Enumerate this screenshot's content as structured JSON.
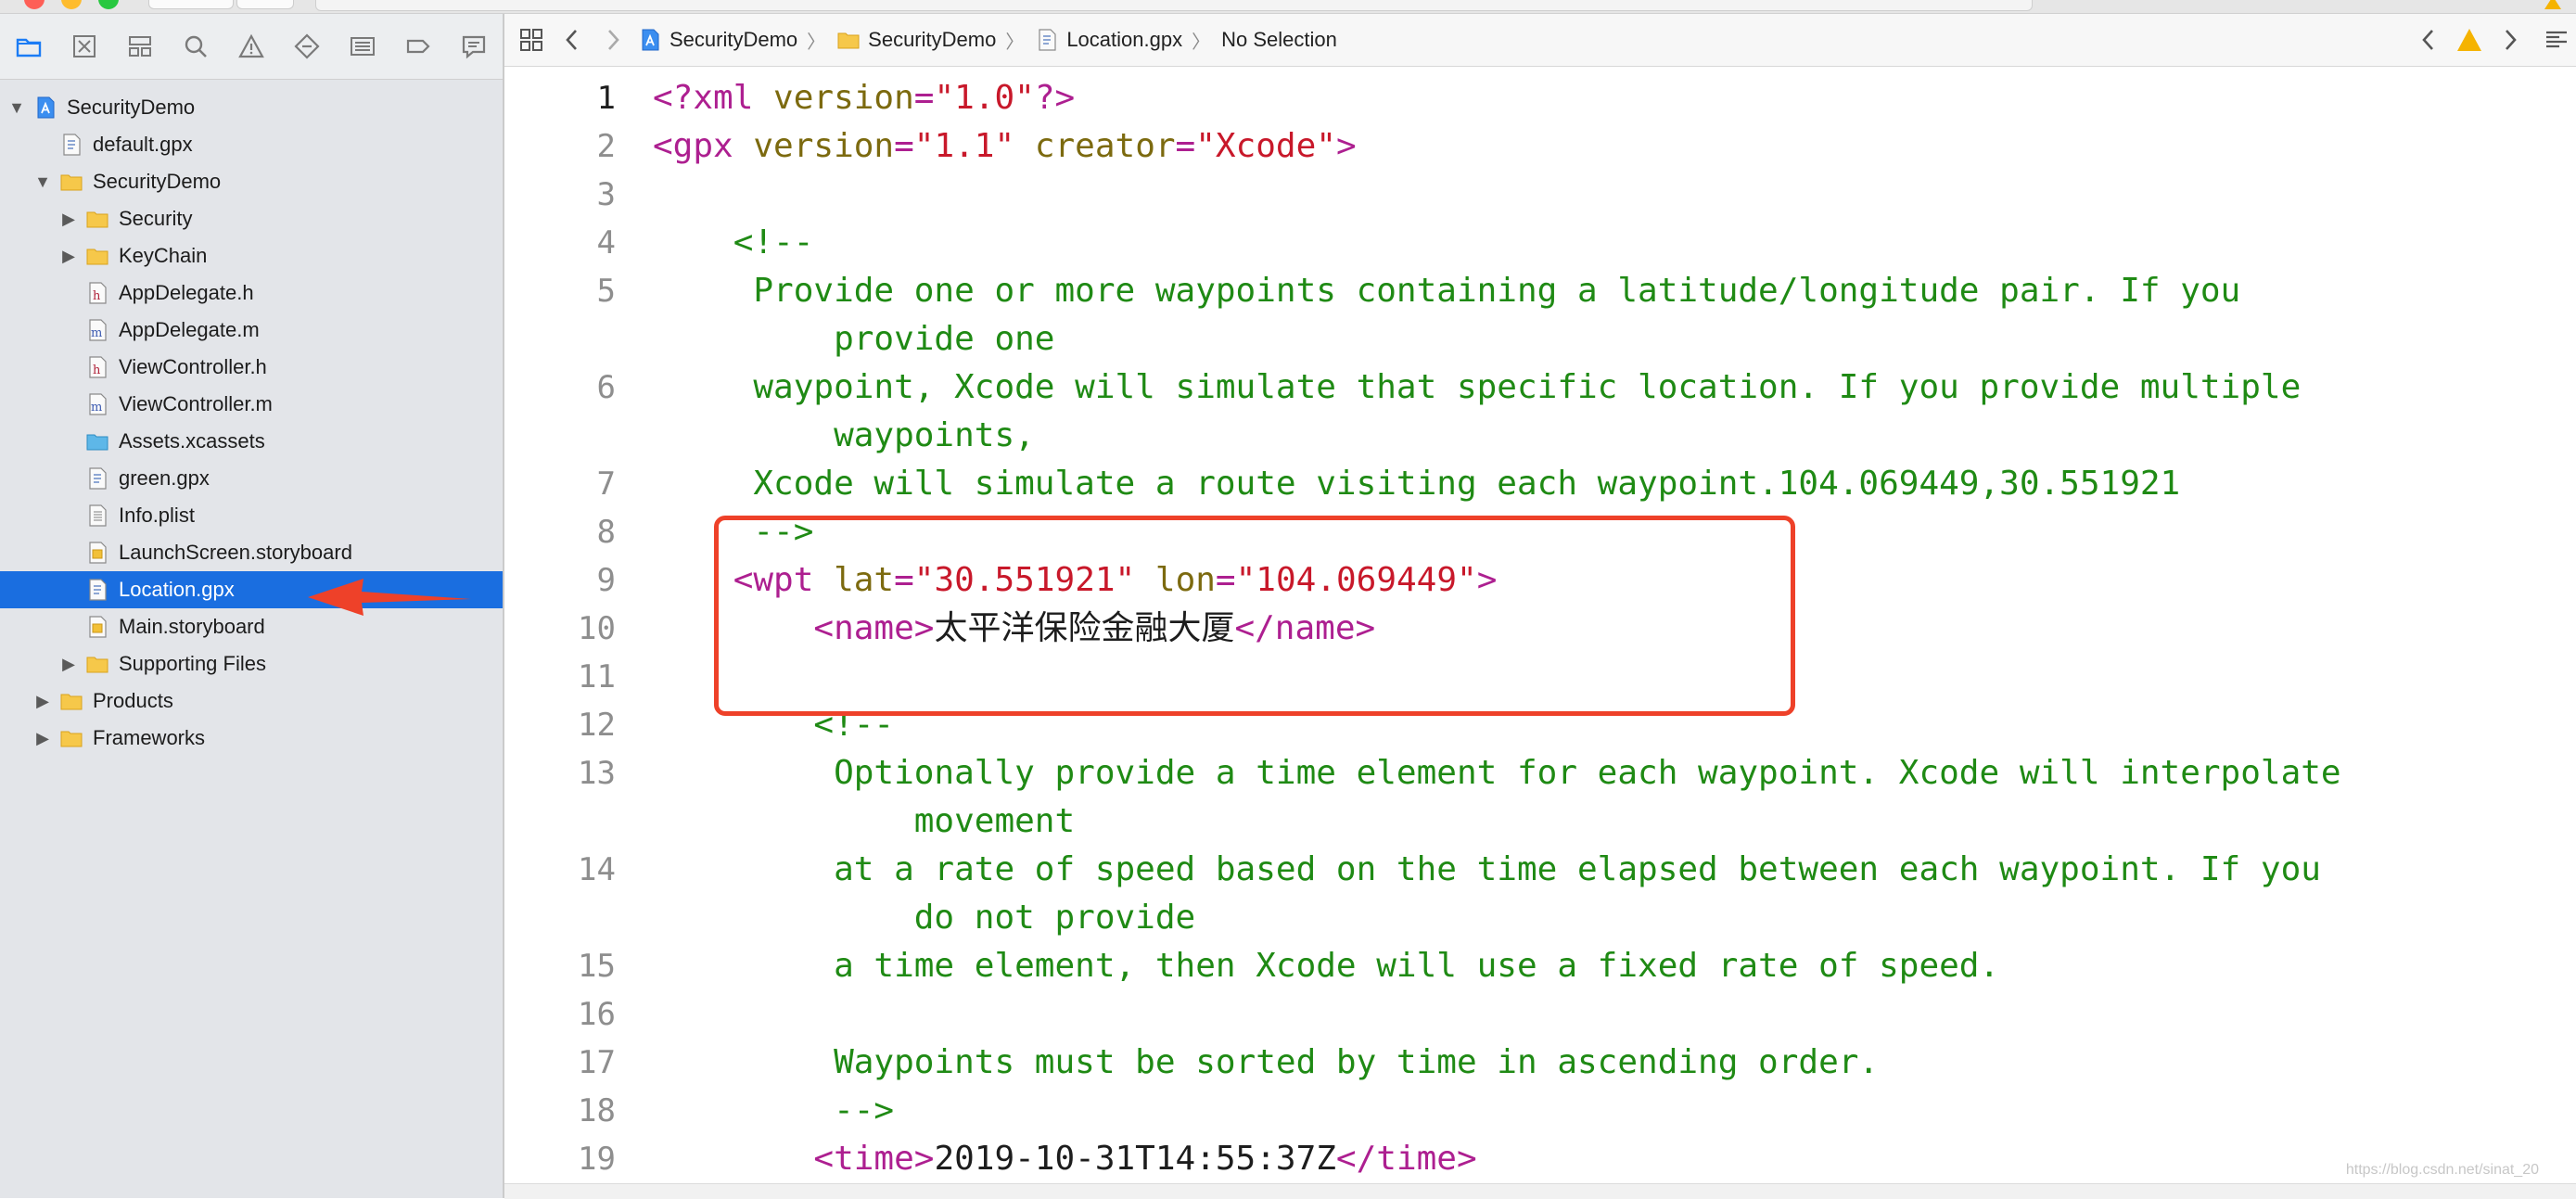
{
  "window": {
    "traffic_lights": [
      "close",
      "minimize",
      "zoom"
    ]
  },
  "navigator": {
    "toolbar_icons": [
      "project-navigator-icon",
      "source-control-icon",
      "symbol-navigator-icon",
      "find-navigator-icon",
      "issue-navigator-icon",
      "test-navigator-icon",
      "debug-navigator-icon",
      "breakpoint-navigator-icon",
      "report-navigator-icon"
    ],
    "items": [
      {
        "label": "SecurityDemo",
        "level": 0,
        "kind": "project",
        "disclosure": "▼"
      },
      {
        "label": "default.gpx",
        "level": 1,
        "kind": "gpx",
        "disclosure": ""
      },
      {
        "label": "SecurityDemo",
        "level": 1,
        "kind": "folder",
        "disclosure": "▼"
      },
      {
        "label": "Security",
        "level": 2,
        "kind": "folder",
        "disclosure": "▶"
      },
      {
        "label": "KeyChain",
        "level": 2,
        "kind": "folder",
        "disclosure": "▶"
      },
      {
        "label": "AppDelegate.h",
        "level": 2,
        "kind": "h",
        "disclosure": ""
      },
      {
        "label": "AppDelegate.m",
        "level": 2,
        "kind": "m",
        "disclosure": ""
      },
      {
        "label": "ViewController.h",
        "level": 2,
        "kind": "h",
        "disclosure": ""
      },
      {
        "label": "ViewController.m",
        "level": 2,
        "kind": "m",
        "disclosure": ""
      },
      {
        "label": "Assets.xcassets",
        "level": 2,
        "kind": "assets",
        "disclosure": ""
      },
      {
        "label": "green.gpx",
        "level": 2,
        "kind": "gpx",
        "disclosure": ""
      },
      {
        "label": "Info.plist",
        "level": 2,
        "kind": "plist",
        "disclosure": ""
      },
      {
        "label": "LaunchScreen.storyboard",
        "level": 2,
        "kind": "storyboard",
        "disclosure": ""
      },
      {
        "label": "Location.gpx",
        "level": 2,
        "kind": "gpx",
        "disclosure": "",
        "selected": true
      },
      {
        "label": "Main.storyboard",
        "level": 2,
        "kind": "storyboard",
        "disclosure": ""
      },
      {
        "label": "Supporting Files",
        "level": 2,
        "kind": "folder",
        "disclosure": "▶"
      },
      {
        "label": "Products",
        "level": 1,
        "kind": "folder",
        "disclosure": "▶"
      },
      {
        "label": "Frameworks",
        "level": 1,
        "kind": "folder",
        "disclosure": "▶"
      }
    ]
  },
  "jumpbar": {
    "crumbs": [
      "SecurityDemo",
      "SecurityDemo",
      "Location.gpx",
      "No Selection"
    ],
    "separator": "〉"
  },
  "editor": {
    "current_line": 1,
    "lines": [
      {
        "n": "1",
        "segs": [
          [
            "c-tag",
            "<?xml "
          ],
          [
            "c-attr",
            "version"
          ],
          [
            "c-tag",
            "="
          ],
          [
            "c-val",
            "\"1.0\""
          ],
          [
            "c-tag",
            "?>"
          ]
        ]
      },
      {
        "n": "2",
        "segs": [
          [
            "c-tag",
            "<gpx "
          ],
          [
            "c-attr",
            "version"
          ],
          [
            "c-tag",
            "="
          ],
          [
            "c-val",
            "\"1.1\""
          ],
          [
            "c-attr",
            " creator"
          ],
          [
            "c-tag",
            "="
          ],
          [
            "c-val",
            "\"Xcode\""
          ],
          [
            "c-tag",
            ">"
          ]
        ]
      },
      {
        "n": "3",
        "segs": []
      },
      {
        "n": "4",
        "segs": [
          [
            "c-comment",
            "    <!--"
          ]
        ]
      },
      {
        "n": "5",
        "segs": [
          [
            "c-comment",
            "     Provide one or more waypoints containing a latitude/longitude pair. If you"
          ]
        ]
      },
      {
        "n": "",
        "segs": [
          [
            "c-comment",
            "         provide one"
          ]
        ]
      },
      {
        "n": "6",
        "segs": [
          [
            "c-comment",
            "     waypoint, Xcode will simulate that specific location. If you provide multiple"
          ]
        ]
      },
      {
        "n": "",
        "segs": [
          [
            "c-comment",
            "         waypoints,"
          ]
        ]
      },
      {
        "n": "7",
        "segs": [
          [
            "c-comment",
            "     Xcode will simulate a route visiting each waypoint.104.069449,30.551921"
          ]
        ]
      },
      {
        "n": "8",
        "segs": [
          [
            "c-comment",
            "     -->"
          ]
        ]
      },
      {
        "n": "9",
        "segs": [
          [
            "c-tag",
            "    <wpt "
          ],
          [
            "c-attr",
            "lat"
          ],
          [
            "c-tag",
            "="
          ],
          [
            "c-val",
            "\"30.551921\""
          ],
          [
            "c-attr",
            " lon"
          ],
          [
            "c-tag",
            "="
          ],
          [
            "c-val",
            "\"104.069449\""
          ],
          [
            "c-tag",
            ">"
          ]
        ]
      },
      {
        "n": "10",
        "segs": [
          [
            "c-tag",
            "        <name>"
          ],
          [
            "c-plain",
            "太平洋保险金融大厦"
          ],
          [
            "c-tag",
            "</name>"
          ]
        ]
      },
      {
        "n": "11",
        "segs": []
      },
      {
        "n": "12",
        "segs": [
          [
            "c-comment",
            "        <!--"
          ]
        ]
      },
      {
        "n": "13",
        "segs": [
          [
            "c-comment",
            "         Optionally provide a time element for each waypoint. Xcode will interpolate"
          ]
        ]
      },
      {
        "n": "",
        "segs": [
          [
            "c-comment",
            "             movement"
          ]
        ]
      },
      {
        "n": "14",
        "segs": [
          [
            "c-comment",
            "         at a rate of speed based on the time elapsed between each waypoint. If you"
          ]
        ]
      },
      {
        "n": "",
        "segs": [
          [
            "c-comment",
            "             do not provide"
          ]
        ]
      },
      {
        "n": "15",
        "segs": [
          [
            "c-comment",
            "         a time element, then Xcode will use a fixed rate of speed."
          ]
        ]
      },
      {
        "n": "16",
        "segs": []
      },
      {
        "n": "17",
        "segs": [
          [
            "c-comment",
            "         Waypoints must be sorted by time in ascending order."
          ]
        ]
      },
      {
        "n": "18",
        "segs": [
          [
            "c-comment",
            "         -->"
          ]
        ]
      },
      {
        "n": "19",
        "segs": [
          [
            "c-tag",
            "        <time>"
          ],
          [
            "c-plain",
            "2019-10-31T14:55:37Z"
          ],
          [
            "c-tag",
            "</time>"
          ]
        ]
      }
    ]
  },
  "colors": {
    "selection": "#1a6ee0",
    "annotation": "#ee4129",
    "comment": "#1f8a14",
    "tag": "#ad1f90",
    "attr": "#7c6a0f",
    "value": "#c8182a"
  },
  "watermark": "https://blog.csdn.net/sinat_20"
}
